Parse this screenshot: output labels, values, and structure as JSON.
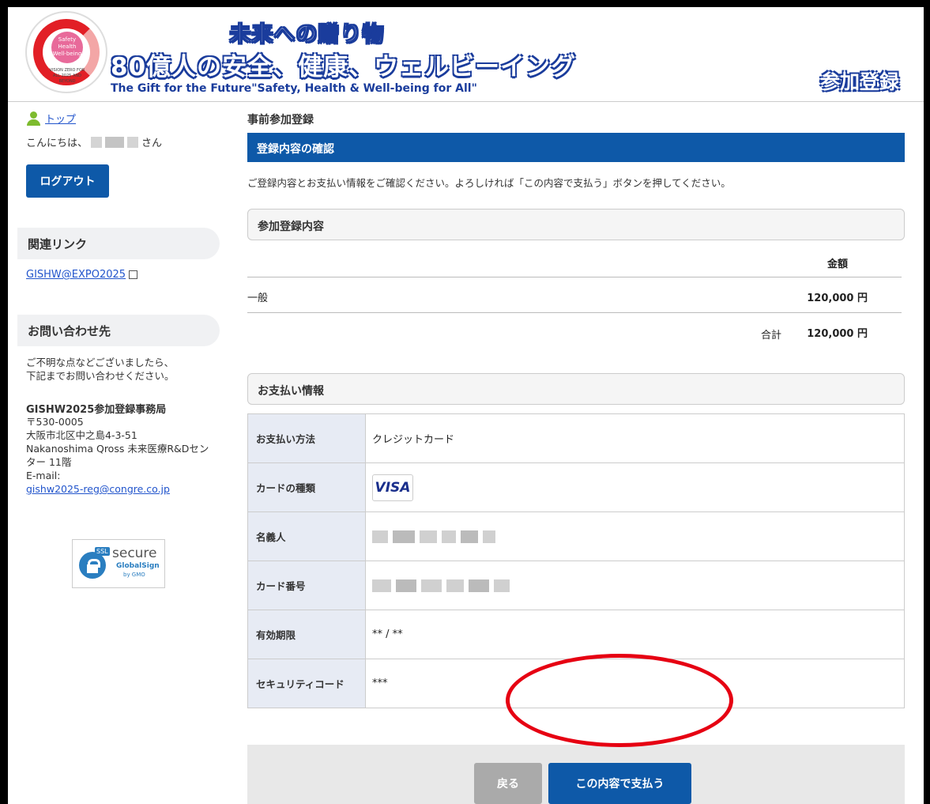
{
  "header": {
    "logo_text": "Safety Health Well-being",
    "logo_sub": "VISION ZERO FOR ALL 2025 AND BEYOND",
    "title_line1": "未来への贈り物",
    "title_line2": "80億人の安全、健康、ウェルビーイング",
    "title_en": "The Gift for the Future\"Safety, Health & Well-being for All\"",
    "badge": "参加登録"
  },
  "sidebar": {
    "top_link": "トップ",
    "greeting_prefix": "こんにちは、",
    "greeting_suffix": "さん",
    "logout_label": "ログアウト",
    "links_heading": "関連リンク",
    "link_label": "GISHW@EXPO2025",
    "contact_heading": "お問い合わせ先",
    "contact_line1": "ご不明な点などございましたら、",
    "contact_line2": "下記までお問い合わせください。",
    "org_name": "GISHW2025参加登録事務局",
    "postal": "〒530-0005",
    "address1": "大阪市北区中之島4-3-51",
    "address2": "Nakanoshima Qross 未来医療R&Dセン",
    "address3": "ター 11階",
    "email_label": "E-mail:",
    "email": "gishw2025-reg@congre.co.jp",
    "ssl_tag": "SSL",
    "ssl_secure": "secure",
    "ssl_brand": "GlobalSign",
    "ssl_by": "by GMO"
  },
  "main": {
    "page_title": "事前参加登録",
    "section_title": "登録内容の確認",
    "instructions": "ご登録内容とお支払い情報をご確認ください。よろしければ「この内容で支払う」ボタンを押してください。",
    "registration_heading": "参加登録内容",
    "amount_header": "金額",
    "category": "一般",
    "category_amount": "120,000 円",
    "total_label": "合計",
    "total_amount": "120,000 円",
    "payment_heading": "お支払い情報",
    "payment_rows": [
      {
        "label": "お支払い方法",
        "value": "クレジットカード"
      },
      {
        "label": "カードの種類",
        "value": "VISA"
      },
      {
        "label": "名義人",
        "value": ""
      },
      {
        "label": "カード番号",
        "value": ""
      },
      {
        "label": "有効期限",
        "value": "** / **"
      },
      {
        "label": "セキュリティコード",
        "value": "***"
      }
    ],
    "back_label": "戻る",
    "pay_label": "この内容で支払う"
  },
  "colors": {
    "primary": "#0e59a8",
    "highlight": "#e60012",
    "label_bg": "#e7ebf4"
  }
}
